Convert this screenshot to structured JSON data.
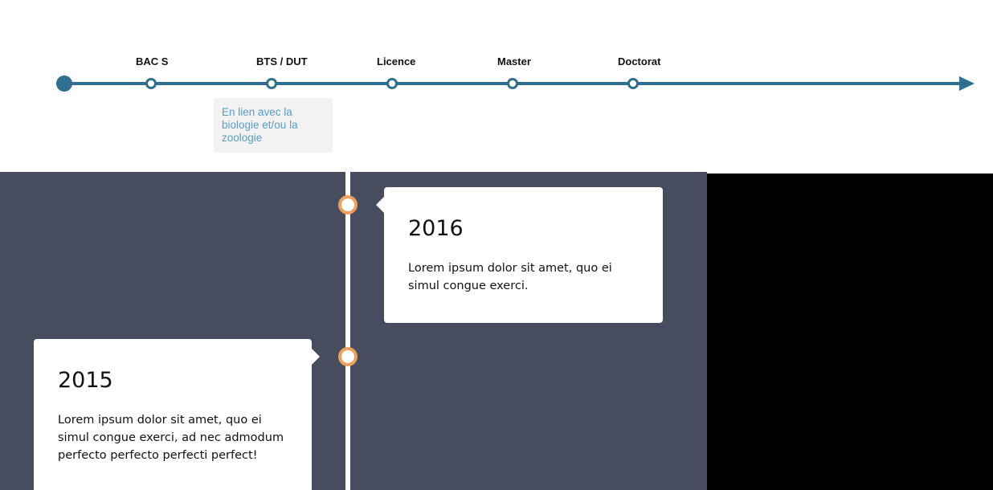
{
  "education_timeline": {
    "steps": [
      {
        "label": "BAC S"
      },
      {
        "label": "BTS / DUT"
      },
      {
        "label": "Licence"
      },
      {
        "label": "Master"
      },
      {
        "label": "Doctorat"
      }
    ],
    "note": "En lien avec la biologie et/ou la zoologie"
  },
  "vertical_timeline": {
    "entries": [
      {
        "year": "2016",
        "text": "Lorem ipsum dolor sit amet, quo ei simul congue exerci."
      },
      {
        "year": "2015",
        "text": "Lorem ipsum dolor sit amet, quo ei simul congue exerci, ad nec admodum perfecto perfecto perfecti perfect!"
      }
    ]
  },
  "colors": {
    "timeline_blue": "#2f6f8f",
    "section_bg": "#474d5f",
    "node_orange": "#f0a05a",
    "note_text": "#5a9ec4"
  }
}
